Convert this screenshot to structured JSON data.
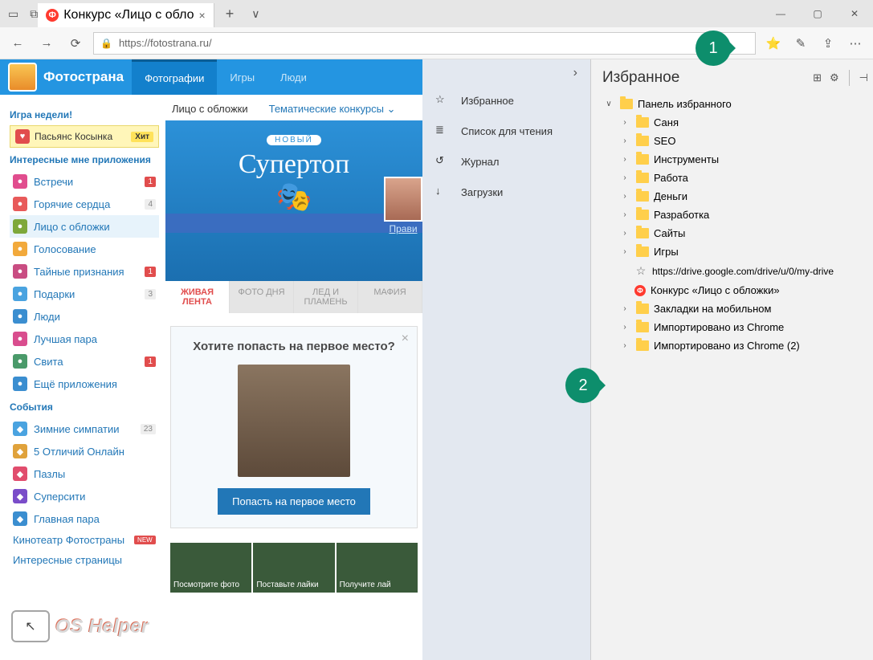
{
  "window": {
    "tab_title": "Конкурс «Лицо с обло"
  },
  "address": {
    "url": "https://fotostrana.ru/"
  },
  "callouts": {
    "one": "1",
    "two": "2"
  },
  "site": {
    "brand": "Фотострана",
    "nav": [
      "Фотографии",
      "Игры",
      "Люди"
    ],
    "sidebar": {
      "game_header": "Игра недели!",
      "hit": {
        "label": "Пасьянс Косынка",
        "tag": "Хит"
      },
      "apps_header": "Интересные мне приложения",
      "apps": [
        {
          "label": "Встречи",
          "badge": "1",
          "red": true,
          "color": "#e14d8e"
        },
        {
          "label": "Горячие сердца",
          "badge": "4",
          "color": "#e85a5a"
        },
        {
          "label": "Лицо с обложки",
          "active": true,
          "color": "#7ea83b"
        },
        {
          "label": "Голосование",
          "color": "#f2a93b"
        },
        {
          "label": "Тайные признания",
          "badge": "1",
          "red": true,
          "color": "#c94d82"
        },
        {
          "label": "Подарки",
          "badge": "3",
          "color": "#4aa3e0"
        },
        {
          "label": "Люди",
          "color": "#3b8ed0"
        },
        {
          "label": "Лучшая пара",
          "color": "#d94d8e"
        },
        {
          "label": "Свита",
          "badge": "1",
          "red": true,
          "color": "#4a9a6a"
        },
        {
          "label": "Ещё приложения",
          "color": "#3b8ed0"
        }
      ],
      "events_header": "События",
      "events": [
        {
          "label": "Зимние симпатии",
          "badge": "23",
          "color": "#4aa3e0"
        },
        {
          "label": "5 Отличий Онлайн",
          "color": "#e0a23b"
        },
        {
          "label": "Пазлы",
          "color": "#e14d6d"
        },
        {
          "label": "Суперсити",
          "color": "#7a4dc9"
        },
        {
          "label": "Главная пара",
          "color": "#3b8ed0"
        }
      ],
      "cinema": "Кинотеатр Фотостраны",
      "pages": "Интересные страницы",
      "new_tag": "NEW"
    },
    "subnav": {
      "cover": "Лицо с обложки",
      "themed": "Тематические конкурсы",
      "chev": "⌄"
    },
    "banner": {
      "new": "НОВЫЙ",
      "title": "Супертоп",
      "rules": "Прави"
    },
    "tabs": [
      "ЖИВАЯ ЛЕНТА",
      "ФОТО ДНЯ",
      "ЛЕД И ПЛАМЕНЬ",
      "МАФИЯ"
    ],
    "promo": {
      "title": "Хотите попасть на первое место?",
      "button": "Попасть на первое место"
    },
    "strip": [
      "Посмотрите фото",
      "Поставьте лайки",
      "Получите лай"
    ]
  },
  "hub": {
    "items": [
      {
        "label": "Избранное",
        "icon": "star"
      },
      {
        "label": "Список для чтения",
        "icon": "list"
      },
      {
        "label": "Журнал",
        "icon": "history"
      },
      {
        "label": "Загрузки",
        "icon": "download"
      }
    ]
  },
  "favorites": {
    "title": "Избранное",
    "root": "Панель избранного",
    "folders": [
      "Саня",
      "SEO",
      "Инструменты",
      "Работа",
      "Деньги",
      "Разработка",
      "Сайты",
      "Игры"
    ],
    "links": [
      {
        "type": "star",
        "label": "https://drive.google.com/drive/u/0/my-drive"
      },
      {
        "type": "icon",
        "label": "Конкурс «Лицо с обложки»"
      }
    ],
    "siblings": [
      "Закладки на мобильном",
      "Импортировано из Chrome",
      "Импортировано из Chrome (2)"
    ]
  },
  "watermark": "OS Helper"
}
